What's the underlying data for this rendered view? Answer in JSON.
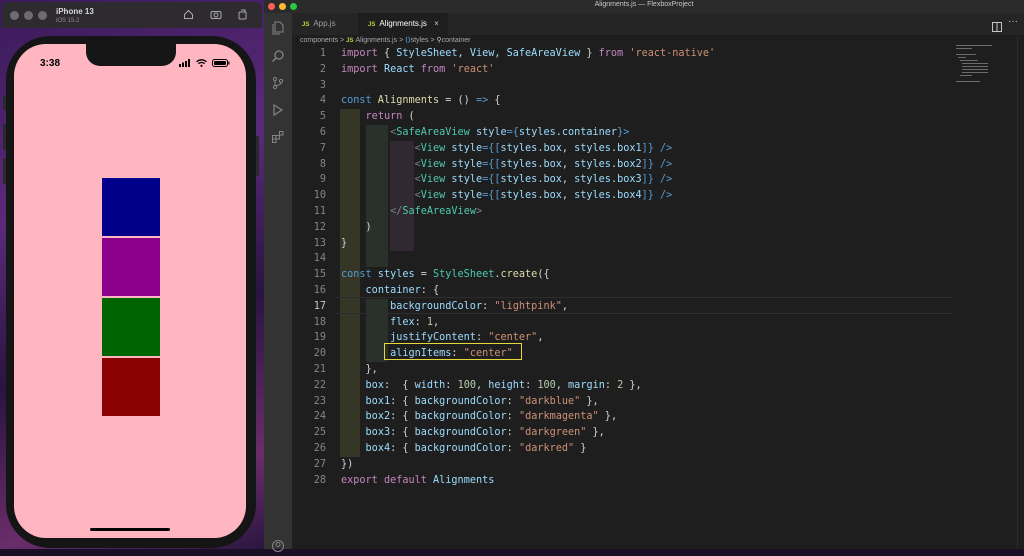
{
  "simulator": {
    "device_name": "iPhone 13",
    "os_version": "iOS 15.2",
    "toolbar_icons": [
      "home-icon",
      "screenshot-icon",
      "rotate-icon"
    ]
  },
  "phone": {
    "time": "3:38",
    "background_color": "#ffb6c1",
    "boxes": [
      {
        "name": "box1",
        "color": "#00008b"
      },
      {
        "name": "box2",
        "color": "#8b008b"
      },
      {
        "name": "box3",
        "color": "#006400"
      },
      {
        "name": "box4",
        "color": "#8b0000"
      }
    ]
  },
  "vscode": {
    "window_title": "Alignments.js — FlexboxProject",
    "tabs": [
      {
        "badge": "JS",
        "label": "App.js",
        "active": false
      },
      {
        "badge": "JS",
        "label": "Alignments.js",
        "active": true,
        "close": "×"
      }
    ],
    "breadcrumb": {
      "folder": "components",
      "file_badge": "JS",
      "file": "Alignments.js",
      "symbol1": "styles",
      "symbol2": "container",
      "separator": ">"
    },
    "current_line": 17,
    "highlighted_line": 20,
    "activity_icons": [
      "files-icon",
      "search-icon",
      "source-control-icon",
      "run-debug-icon",
      "extensions-icon",
      "account-icon"
    ]
  },
  "code": {
    "line_numbers": [
      "1",
      "2",
      "3",
      "4",
      "5",
      "6",
      "7",
      "8",
      "9",
      "10",
      "11",
      "12",
      "13",
      "14",
      "15",
      "16",
      "17",
      "18",
      "19",
      "20",
      "21",
      "22",
      "23",
      "24",
      "25",
      "26",
      "27",
      "28"
    ],
    "l1": {
      "import": "import",
      "brace_open": " { ",
      "names": "StyleSheet, View, SafeAreaView",
      "brace_close": " } ",
      "from": "from",
      "module": "'react-native'"
    },
    "l2": {
      "import": "import",
      "name": " React ",
      "from": "from",
      "module": " 'react'"
    },
    "l4": {
      "const": "const",
      "name": " Alignments",
      "rest": " = () ",
      "arrow": "=>",
      "brace": " {"
    },
    "l5": {
      "return": "return",
      "paren": " ("
    },
    "l6": {
      "open": "<",
      "comp": "SafeAreaView",
      "attr": " style",
      "eq": "={",
      "val": "styles.container",
      "close": "}>"
    },
    "l7": {
      "open": "<",
      "comp": "View",
      "attr": " style",
      "eq": "={[",
      "val1": "styles.box",
      "comma": ", ",
      "val2": "styles.box1",
      "close": "]} />"
    },
    "l8": {
      "open": "<",
      "comp": "View",
      "attr": " style",
      "eq": "={[",
      "val1": "styles.box",
      "comma": ", ",
      "val2": "styles.box2",
      "close": "]} />"
    },
    "l9": {
      "open": "<",
      "comp": "View",
      "attr": " style",
      "eq": "={[",
      "val1": "styles.box",
      "comma": ", ",
      "val2": "styles.box3",
      "close": "]} />"
    },
    "l10": {
      "open": "<",
      "comp": "View",
      "attr": " style",
      "eq": "={[",
      "val1": "styles.box",
      "comma": ", ",
      "val2": "styles.box4",
      "close": "]} />"
    },
    "l11": {
      "open": "</",
      "comp": "SafeAreaView",
      "close": ">"
    },
    "l12": ")",
    "l13": "}",
    "l15": {
      "const": "const",
      "name": " styles",
      "eq": " = ",
      "cls": "StyleSheet",
      "dot": ".",
      "fn": "create",
      "rest": "({"
    },
    "l16": {
      "key": "container",
      "rest": ": {"
    },
    "l17": {
      "key": "backgroundColor",
      "colon": ": ",
      "val": "\"lightpink\"",
      "comma": ","
    },
    "l18": {
      "key": "flex",
      "colon": ": ",
      "val": "1",
      "comma": ","
    },
    "l19": {
      "key": "justifyContent",
      "colon": ": ",
      "val": "\"center\"",
      "comma": ","
    },
    "l20": {
      "key": "alignItems",
      "colon": ": ",
      "val": "\"center\""
    },
    "l21": "},",
    "l22": {
      "key": "box",
      "colon": ":  { ",
      "k1": "width",
      "c1": ": ",
      "v1": "100",
      "s1": ", ",
      "k2": "height",
      "c2": ": ",
      "v2": "100",
      "s2": ", ",
      "k3": "margin",
      "c3": ": ",
      "v3": "2",
      "end": "},"
    },
    "l23": {
      "key": "box1",
      "colon": ": { ",
      "k": "backgroundColor",
      "c": ": ",
      "v": "\"darkblue\"",
      "end": " },"
    },
    "l24": {
      "key": "box2",
      "colon": ": { ",
      "k": "backgroundColor",
      "c": ": ",
      "v": "\"darkmagenta\"",
      "end": " },"
    },
    "l25": {
      "key": "box3",
      "colon": ": { ",
      "k": "backgroundColor",
      "c": ": ",
      "v": "\"darkgreen\"",
      "end": " },"
    },
    "l26": {
      "key": "box4",
      "colon": ": { ",
      "k": "backgroundColor",
      "c": ": ",
      "v": "\"darkred\"",
      "end": " }"
    },
    "l27": "})",
    "l28": {
      "export": "export",
      "default": " default",
      "name": " Alignments"
    }
  }
}
